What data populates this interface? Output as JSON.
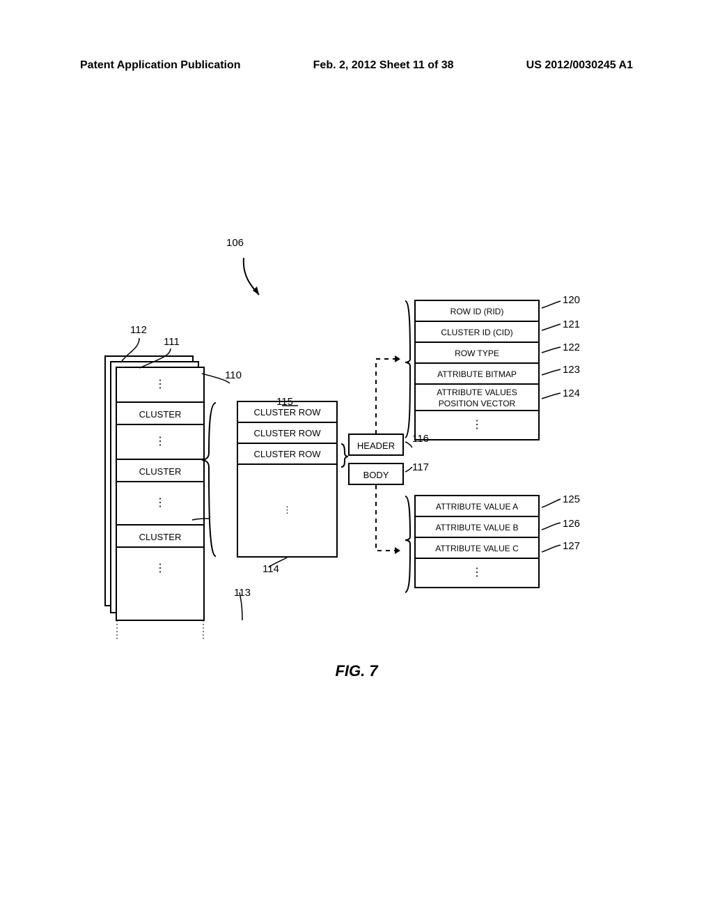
{
  "header": {
    "left": "Patent Application Publication",
    "mid": "Feb. 2, 2012  Sheet 11 of 38",
    "right": "US 2012/0030245 A1"
  },
  "figure_caption": "FIG. 7",
  "refs": {
    "r106": "106",
    "r110": "110",
    "r111": "111",
    "r112": "112",
    "r113": "113",
    "r114": "114",
    "r115": "115",
    "r116": "116",
    "r117": "117",
    "r120": "120",
    "r121": "121",
    "r122": "122",
    "r123": "123",
    "r124": "124",
    "r125": "125",
    "r126": "126",
    "r127": "127"
  },
  "left_column": {
    "cell1": "CLUSTER",
    "cell2": "CLUSTER",
    "cell3": "CLUSTER"
  },
  "mid_column": {
    "row1": "CLUSTER ROW",
    "row2": "CLUSTER ROW",
    "row3": "CLUSTER ROW"
  },
  "header_body": {
    "header": "HEADER",
    "body": "BODY"
  },
  "right_top": {
    "r1": "ROW ID (RID)",
    "r2": "CLUSTER ID (CID)",
    "r3": "ROW TYPE",
    "r4": "ATTRIBUTE BITMAP",
    "r5": "ATTRIBUTE VALUES POSITION VECTOR"
  },
  "right_bot": {
    "r1": "ATTRIBUTE VALUE A",
    "r2": "ATTRIBUTE VALUE B",
    "r3": "ATTRIBUTE VALUE C"
  },
  "vdots_glyph": "⋮"
}
